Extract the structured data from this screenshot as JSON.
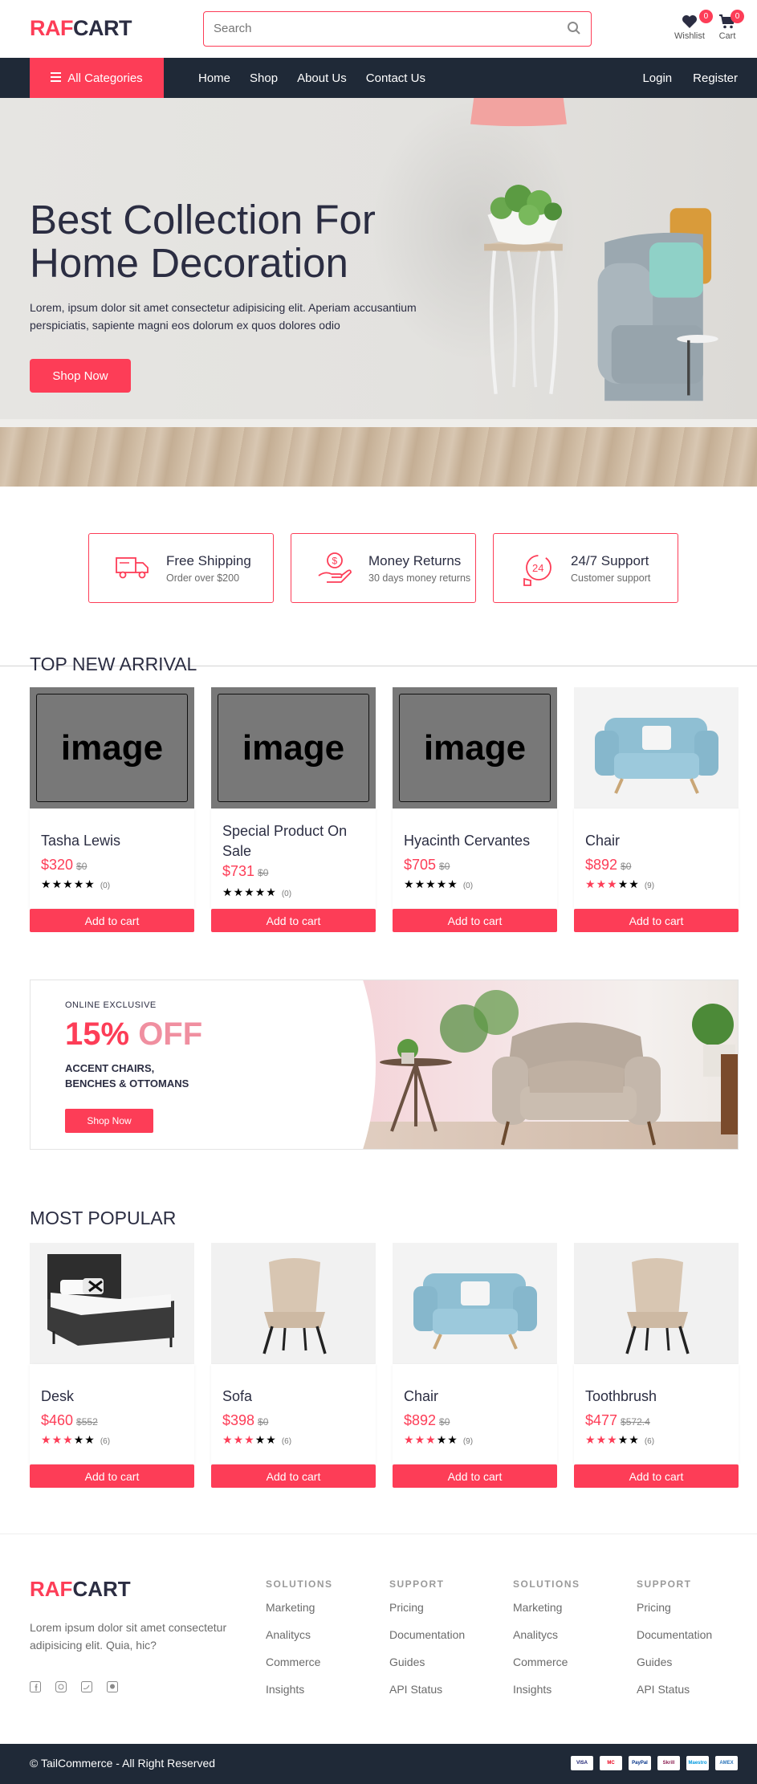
{
  "brand": {
    "part1": "RAF",
    "part2": "CART"
  },
  "search": {
    "placeholder": "Search"
  },
  "header_icons": {
    "wishlist": {
      "label": "Wishlist",
      "count": "0"
    },
    "cart": {
      "label": "Cart",
      "count": "0"
    }
  },
  "nav": {
    "all_categories": "All Categories",
    "links": [
      "Home",
      "Shop",
      "About Us",
      "Contact Us"
    ],
    "login": "Login",
    "register": "Register"
  },
  "hero": {
    "title_line1": "Best Collection For",
    "title_line2": "Home Decoration",
    "text": "Lorem, ipsum dolor sit amet consectetur adipisicing elit. Aperiam accusantium perspiciatis, sapiente magni eos dolorum ex quos dolores odio",
    "button": "Shop Now"
  },
  "features": [
    {
      "title": "Free Shipping",
      "sub": "Order over $200",
      "icon": "truck-icon"
    },
    {
      "title": "Money Returns",
      "sub": "30 days money returns",
      "icon": "money-return-icon"
    },
    {
      "title": "24/7 Support",
      "sub": "Customer support",
      "icon": "support-24-icon"
    }
  ],
  "top_new_arrival": {
    "title": "TOP NEW ARRIVAL",
    "products": [
      {
        "name": "Tasha Lewis",
        "price": "$320",
        "old_price": "$0",
        "rating": 0,
        "reviews": "(0)",
        "image": "placeholder",
        "image_text": "image",
        "button": "Add to cart"
      },
      {
        "name": "Special Product On Sale",
        "price": "$731",
        "old_price": "$0",
        "rating": 0,
        "reviews": "(0)",
        "image": "placeholder",
        "image_text": "image",
        "button": "Add to cart"
      },
      {
        "name": "Hyacinth Cervantes",
        "price": "$705",
        "old_price": "$0",
        "rating": 0,
        "reviews": "(0)",
        "image": "placeholder",
        "image_text": "image",
        "button": "Add to cart"
      },
      {
        "name": "Chair",
        "price": "$892",
        "old_price": "$0",
        "rating": 3,
        "reviews": "(9)",
        "image": "blue-armchair",
        "button": "Add to cart"
      }
    ]
  },
  "promo": {
    "small": "ONLINE EXCLUSIVE",
    "percent": "15%",
    "off": "OFF",
    "desc": "ACCENT CHAIRS, BENCHES & OTTOMANS",
    "button": "Shop Now"
  },
  "most_popular": {
    "title": "MOST POPULAR",
    "products": [
      {
        "name": "Desk",
        "price": "$460",
        "old_price": "$552",
        "rating": 3,
        "reviews": "(6)",
        "image": "bed",
        "button": "Add to cart"
      },
      {
        "name": "Sofa",
        "price": "$398",
        "old_price": "$0",
        "rating": 3,
        "reviews": "(6)",
        "image": "beige-chair",
        "button": "Add to cart"
      },
      {
        "name": "Chair",
        "price": "$892",
        "old_price": "$0",
        "rating": 3,
        "reviews": "(9)",
        "image": "blue-armchair",
        "button": "Add to cart"
      },
      {
        "name": "Toothbrush",
        "price": "$477",
        "old_price": "$572.4",
        "rating": 3,
        "reviews": "(6)",
        "image": "beige-chair",
        "button": "Add to cart"
      }
    ]
  },
  "footer": {
    "text": "Lorem ipsum dolor sit amet consectetur adipisicing elit. Quia, hic?",
    "social": [
      "facebook-icon",
      "instagram-icon",
      "twitter-icon",
      "github-icon"
    ],
    "columns": [
      {
        "heading": "SOLUTIONS",
        "links": [
          "Marketing",
          "Analitycs",
          "Commerce",
          "Insights"
        ]
      },
      {
        "heading": "SUPPORT",
        "links": [
          "Pricing",
          "Documentation",
          "Guides",
          "API Status"
        ]
      },
      {
        "heading": "SOLUTIONS",
        "links": [
          "Marketing",
          "Analitycs",
          "Commerce",
          "Insights"
        ]
      },
      {
        "heading": "SUPPORT",
        "links": [
          "Pricing",
          "Documentation",
          "Guides",
          "API Status"
        ]
      }
    ],
    "copyright": "© TailCommerce - All Right Reserved",
    "payments": [
      "VISA",
      "MC",
      "PayPal",
      "Skrill",
      "Maestro",
      "AMEX"
    ]
  },
  "colors": {
    "accent": "#fd3d57",
    "dark": "#1f2937",
    "text": "#2b2d42"
  }
}
